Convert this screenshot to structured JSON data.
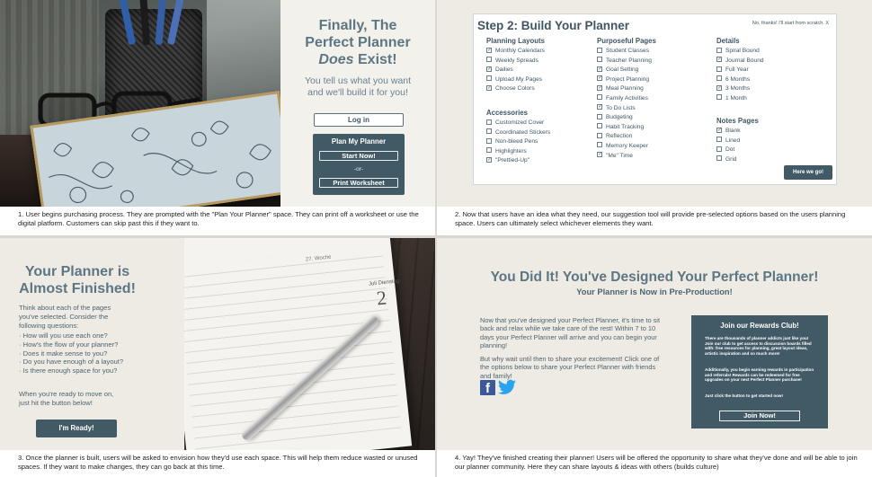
{
  "panel1": {
    "title_line1": "Finally, The",
    "title_line2": "Perfect Planner",
    "title_line3": "Does",
    "title_line3b": " Exist!",
    "subtitle_line1": "You tell us what you want",
    "subtitle_line2": "and we'll build it for you!",
    "login_label": "Log in",
    "plan_title": "Plan My Planner",
    "start_label": "Start Now!",
    "or_label": "-or-",
    "print_label": "Print Worksheet",
    "caption": "1. User begins purchasing process. They are prompted with the \"Plan Your Planner\" space. They can print off a worksheet or use the digital platform. Customers can skip past this if they want to."
  },
  "panel2": {
    "title": "Step 2: Build Your Planner",
    "skip": "No, thanks! I'll start from scratch.  X",
    "columns": [
      {
        "heading": "Planning Layouts",
        "options": [
          {
            "label": "Monthly Calendars",
            "checked": true
          },
          {
            "label": "Weekly Spreads",
            "checked": false
          },
          {
            "label": "Dailies",
            "checked": true
          },
          {
            "label": "Upload My Pages",
            "checked": false
          },
          {
            "label": "Choose Colors",
            "checked": true
          }
        ]
      },
      {
        "heading": "Accessories",
        "options": [
          {
            "label": "Customized Cover",
            "checked": false
          },
          {
            "label": "Coordinated Stickers",
            "checked": false
          },
          {
            "label": "Non-bleed Pens",
            "checked": false
          },
          {
            "label": "Highlighters",
            "checked": false
          },
          {
            "label": "\"Prettied-Up\"",
            "checked": true
          }
        ]
      },
      {
        "heading": "Purposeful Pages",
        "options": [
          {
            "label": "Student Classes",
            "checked": false
          },
          {
            "label": "Teacher Planning",
            "checked": false
          },
          {
            "label": "Goal Setting",
            "checked": true
          },
          {
            "label": "Project Planning",
            "checked": true
          },
          {
            "label": "Meal Planning",
            "checked": true
          },
          {
            "label": "Family Activities",
            "checked": false
          },
          {
            "label": "To Do Lists",
            "checked": true
          },
          {
            "label": "Budgeting",
            "checked": false
          },
          {
            "label": "Habit Tracking",
            "checked": false
          },
          {
            "label": "Reflection",
            "checked": false
          },
          {
            "label": "Memory Keeper",
            "checked": false
          },
          {
            "label": "\"Me\" Time",
            "checked": true
          }
        ]
      },
      {
        "heading": "Details",
        "options": [
          {
            "label": "Spiral Bound",
            "checked": false
          },
          {
            "label": "Journal Bound",
            "checked": true
          },
          {
            "label": "Full Year",
            "checked": false
          },
          {
            "label": "6 Months",
            "checked": false
          },
          {
            "label": "3 Months",
            "checked": true
          },
          {
            "label": "1 Month",
            "checked": false
          }
        ]
      },
      {
        "heading": "Notes Pages",
        "options": [
          {
            "label": "Blank",
            "checked": true
          },
          {
            "label": "Lined",
            "checked": false
          },
          {
            "label": "Dot",
            "checked": false
          },
          {
            "label": "Grid",
            "checked": false
          }
        ]
      }
    ],
    "go_label": "Here we go!",
    "caption": "2. Now that users have an idea what they need, our suggestion tool will provide pre-selected options based on the users planning space. Users can ultimately select whichever elements they want."
  },
  "panel3": {
    "title_line1": "Your Planner is",
    "title_line2": "Almost Finished!",
    "intro": [
      "Think about each of the pages",
      "you've selected. Consider the",
      "following questions:"
    ],
    "questions": [
      "· How will you use each one?",
      "· How's the flow of your planner?",
      "· Does it make sense to you?",
      "· Do you have enough of a layout?",
      "· Is there enough space for you?"
    ],
    "outro": [
      "When you're ready to move on,",
      "just hit the button below!"
    ],
    "ready_label": "I'm Ready!",
    "photo_week": "27. Woche",
    "photo_day": "Juli Dienstag",
    "photo_daynum": "2",
    "caption": "3. Once the planner is built, users will be asked to envision how they'd use each space. This will help them reduce wasted or unused spaces. If they want to make changes, they can go back at this time."
  },
  "panel4": {
    "title": "You Did It! You've Designed Your Perfect Planner!",
    "subtitle": "Your Planner is Now in Pre-Production!",
    "para1": "Now that you've designed your Perfect Planner, it's time to sit back and relax while we take care of the rest! Within 7 to 10 days your Perfect Planner will arrive and you can begin your planning!",
    "para2": "But why wait until then to share your excitement! Click one of the options below to share your Perfect Planner with friends and family!",
    "fb_glyph": "f",
    "tw_glyph": "🐦",
    "rewards_title": "Join our Rewards Club!",
    "rewards_p1": "There are thousands of planner addicts just like you! Join our club to get access to discussion boards filled with: free resources for planning, great layout ideas, artistic inspiration and so much more!",
    "rewards_p2": "Additionally, you begin earning rewards in participation and referrals! Rewards can be redeemed for free upgrades on your next Perfect Planner purchase!",
    "rewards_p3": "Just click the button to get started now!",
    "join_label": "Join Now!",
    "caption": "4. Yay! They've finished creating their planner! Users will be offered the opportunity to share what they've done and will be able to join our planner community. Here they can share layouts & ideas with others (builds culture)"
  }
}
